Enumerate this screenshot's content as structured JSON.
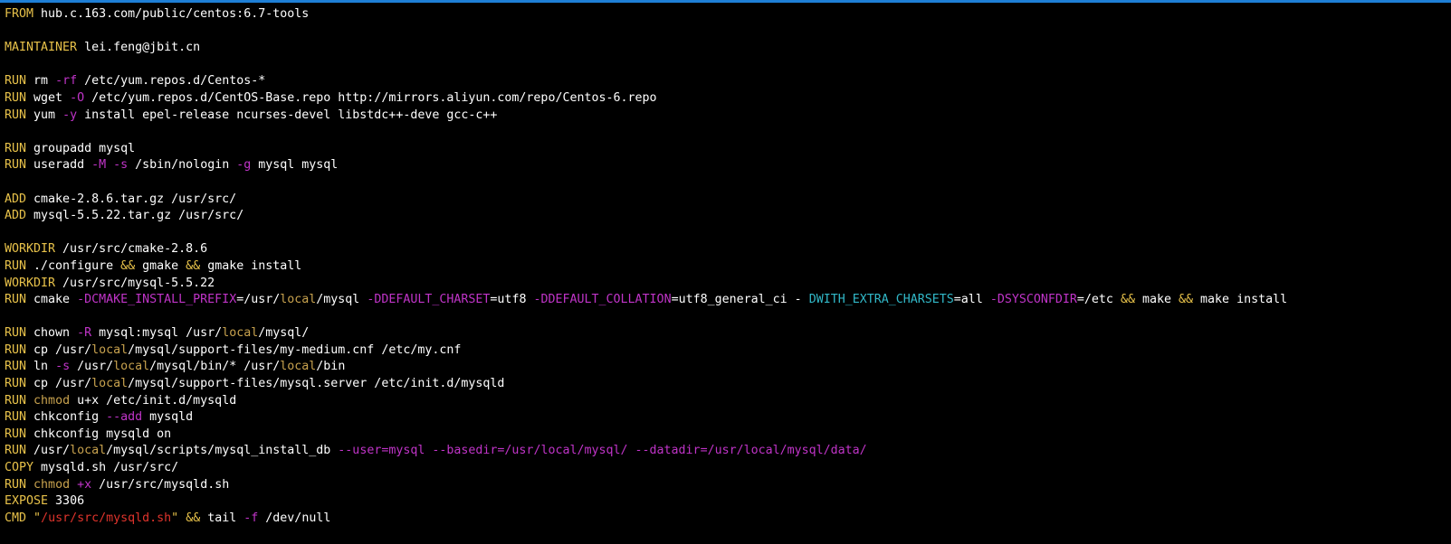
{
  "window": {
    "accent_color": "#1e7fd6",
    "background_color": "#000000"
  },
  "colors": {
    "default": "#ffffff",
    "keyword": "#e8c24a",
    "flag": "#c034c8",
    "local": "#c8a24e",
    "operator": "#e8c24a",
    "variable_cyan": "#31b8c8",
    "string": "#e0342c"
  },
  "lines": [
    [
      [
        "kw",
        "FROM"
      ],
      [
        "w",
        " hub.c.163.com/public/centos:6.7-tools"
      ]
    ],
    [],
    [
      [
        "kw",
        "MAINTAINER"
      ],
      [
        "w",
        " lei.feng@jbit.cn"
      ]
    ],
    [],
    [
      [
        "kw",
        "RUN"
      ],
      [
        "w",
        " rm "
      ],
      [
        "flag",
        "-rf"
      ],
      [
        "w",
        " /etc/yum.repos.d/Centos-*"
      ]
    ],
    [
      [
        "kw",
        "RUN"
      ],
      [
        "w",
        " wget "
      ],
      [
        "flag",
        "-O"
      ],
      [
        "w",
        " /etc/yum.repos.d/CentOS-Base.repo http://mirrors.aliyun.com/repo/Centos-6.repo"
      ]
    ],
    [
      [
        "kw",
        "RUN"
      ],
      [
        "w",
        " yum "
      ],
      [
        "flag",
        "-y"
      ],
      [
        "w",
        " install epel-release ncurses-devel libstdc++-deve gcc-c++"
      ]
    ],
    [],
    [
      [
        "kw",
        "RUN"
      ],
      [
        "w",
        " groupadd mysql"
      ]
    ],
    [
      [
        "kw",
        "RUN"
      ],
      [
        "w",
        " useradd "
      ],
      [
        "flag",
        "-M"
      ],
      [
        "w",
        " "
      ],
      [
        "flag",
        "-s"
      ],
      [
        "w",
        " /sbin/nologin "
      ],
      [
        "flag",
        "-g"
      ],
      [
        "w",
        " mysql mysql"
      ]
    ],
    [],
    [
      [
        "kw",
        "ADD"
      ],
      [
        "w",
        " cmake-2.8.6.tar.gz /usr/src/"
      ]
    ],
    [
      [
        "kw",
        "ADD"
      ],
      [
        "w",
        " mysql-5.5.22.tar.gz /usr/src/"
      ]
    ],
    [],
    [
      [
        "kw",
        "WORKDIR"
      ],
      [
        "w",
        " /usr/src/cmake-2.8.6"
      ]
    ],
    [
      [
        "kw",
        "RUN"
      ],
      [
        "w",
        " ./configure "
      ],
      [
        "op",
        "&&"
      ],
      [
        "w",
        " gmake "
      ],
      [
        "op",
        "&&"
      ],
      [
        "w",
        " gmake install"
      ]
    ],
    [
      [
        "kw",
        "WORKDIR"
      ],
      [
        "w",
        " /usr/src/mysql-5.5.22"
      ]
    ],
    [
      [
        "kw",
        "RUN"
      ],
      [
        "w",
        " cmake "
      ],
      [
        "flag",
        "-DCMAKE_INSTALL_PREFIX"
      ],
      [
        "w",
        "=/usr/"
      ],
      [
        "local",
        "local"
      ],
      [
        "w",
        "/mysql "
      ],
      [
        "flag",
        "-DDEFAULT_CHARSET"
      ],
      [
        "w",
        "=utf8 "
      ],
      [
        "flag",
        "-DDEFAULT_COLLATION"
      ],
      [
        "w",
        "=utf8_general_ci - "
      ],
      [
        "cyan",
        "DWITH_EXTRA_CHARSETS"
      ],
      [
        "w",
        "=all "
      ],
      [
        "flag",
        "-DSYSCONFDIR"
      ],
      [
        "w",
        "=/etc "
      ],
      [
        "op",
        "&&"
      ],
      [
        "w",
        " make "
      ],
      [
        "op",
        "&&"
      ],
      [
        "w",
        " make install"
      ]
    ],
    [],
    [
      [
        "kw",
        "RUN"
      ],
      [
        "w",
        " chown "
      ],
      [
        "flag",
        "-R"
      ],
      [
        "w",
        " mysql:mysql /usr/"
      ],
      [
        "local",
        "local"
      ],
      [
        "w",
        "/mysql/"
      ]
    ],
    [
      [
        "kw",
        "RUN"
      ],
      [
        "w",
        " cp /usr/"
      ],
      [
        "local",
        "local"
      ],
      [
        "w",
        "/mysql/support-files/my-medium.cnf /etc/my.cnf"
      ]
    ],
    [
      [
        "kw",
        "RUN"
      ],
      [
        "w",
        " ln "
      ],
      [
        "flag",
        "-s"
      ],
      [
        "w",
        " /usr/"
      ],
      [
        "local",
        "local"
      ],
      [
        "w",
        "/mysql/bin/* /usr/"
      ],
      [
        "local",
        "local"
      ],
      [
        "w",
        "/bin"
      ]
    ],
    [
      [
        "kw",
        "RUN"
      ],
      [
        "w",
        " cp /usr/"
      ],
      [
        "local",
        "local"
      ],
      [
        "w",
        "/mysql/support-files/mysql.server /etc/init.d/mysqld"
      ]
    ],
    [
      [
        "kw",
        "RUN"
      ],
      [
        "w",
        " "
      ],
      [
        "local",
        "chmod"
      ],
      [
        "w",
        " u+x /etc/init.d/mysqld"
      ]
    ],
    [
      [
        "kw",
        "RUN"
      ],
      [
        "w",
        " chkconfig "
      ],
      [
        "flag",
        "--add"
      ],
      [
        "w",
        " mysqld"
      ]
    ],
    [
      [
        "kw",
        "RUN"
      ],
      [
        "w",
        " chkconfig mysqld on"
      ]
    ],
    [
      [
        "kw",
        "RUN"
      ],
      [
        "w",
        " /usr/"
      ],
      [
        "local",
        "local"
      ],
      [
        "w",
        "/mysql/scripts/mysql_install_db "
      ],
      [
        "flag",
        "--user=mysql --basedir=/usr/local/mysql/ --datadir=/usr/local/mysql/data/"
      ]
    ],
    [
      [
        "kw",
        "COPY"
      ],
      [
        "w",
        " mysqld.sh /usr/src/"
      ]
    ],
    [
      [
        "kw",
        "RUN"
      ],
      [
        "w",
        " "
      ],
      [
        "local",
        "chmod"
      ],
      [
        "w",
        " "
      ],
      [
        "flag",
        "+x"
      ],
      [
        "w",
        " /usr/src/mysqld.sh"
      ]
    ],
    [
      [
        "kw",
        "EXPOSE"
      ],
      [
        "w",
        " 3306"
      ]
    ],
    [
      [
        "kw",
        "CMD"
      ],
      [
        "w",
        " "
      ],
      [
        "quote",
        "\""
      ],
      [
        "str",
        "/usr/src/mysqld.sh"
      ],
      [
        "quote",
        "\""
      ],
      [
        "w",
        " "
      ],
      [
        "op",
        "&&"
      ],
      [
        "w",
        " tail "
      ],
      [
        "flag",
        "-f"
      ],
      [
        "w",
        " /dev/null"
      ]
    ]
  ]
}
